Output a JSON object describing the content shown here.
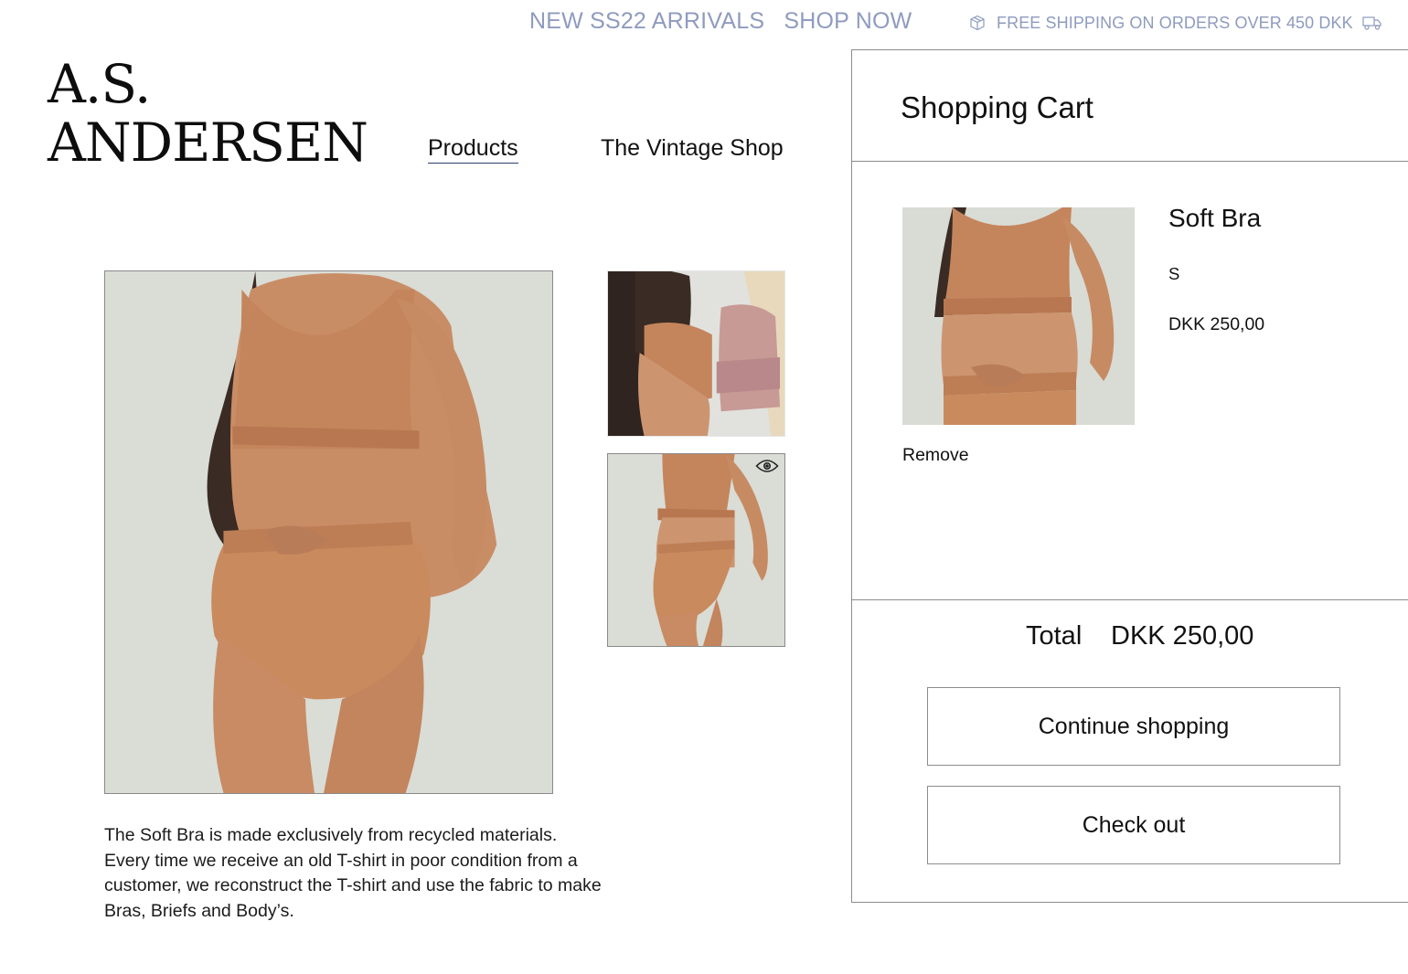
{
  "announcement": {
    "text": "NEW SS22 ARRIVALS",
    "link": "SHOP NOW"
  },
  "shipping": {
    "text": "FREE SHIPPING ON ORDERS OVER 450 DKK",
    "icon_left": "box-icon",
    "icon_right": "truck-icon"
  },
  "brand": {
    "line1": "A.S.",
    "line2": "ANDERSEN"
  },
  "nav": {
    "items": [
      {
        "label": "Products",
        "active": true
      },
      {
        "label": "The Vintage Shop",
        "active": false
      }
    ]
  },
  "product": {
    "description_lines": [
      "The Soft Bra is made exclusively from recycled materials.",
      "Every time we receive an old T-shirt in poor condition from a",
      "customer, we reconstruct the T-shirt and use the fabric to make",
      "Bras, Briefs and Body’s."
    ],
    "eye_icon": "eye-icon"
  },
  "cart": {
    "title": "Shopping Cart",
    "items": [
      {
        "name": "Soft Bra",
        "size": "S",
        "price": "DKK 250,00",
        "remove_label": "Remove"
      }
    ],
    "total_label": "Total",
    "total_value": "DKK 250,00",
    "continue_label": "Continue shopping",
    "checkout_label": "Check out"
  },
  "colors": {
    "announcement": "#8f9bbf",
    "nav_underline": "#2b3f6a",
    "product_tone": "#c98a5e",
    "photo_background": "#d9dbd5",
    "border": "#8c8c8c"
  }
}
